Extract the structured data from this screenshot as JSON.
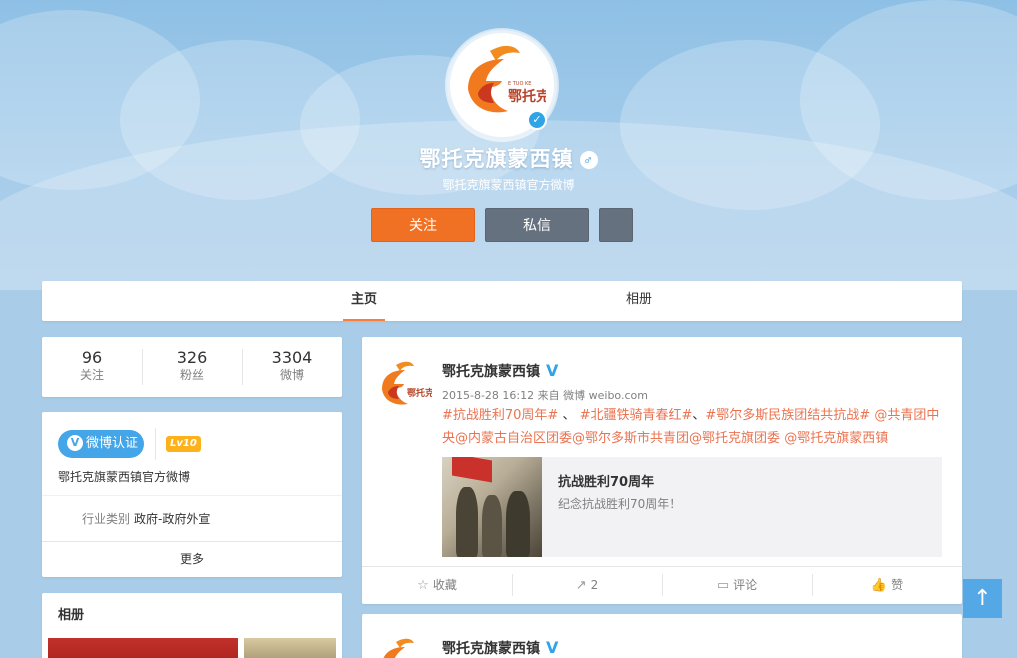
{
  "profile": {
    "name": "鄂托克旗蒙西镇",
    "description": "鄂托克旗蒙西镇官方微博",
    "gender_icon": "♂",
    "avatar_logo_text": "鄂托克",
    "avatar_logo_small": "E TUO KE"
  },
  "buttons": {
    "follow": "关注",
    "message": "私信",
    "more": ""
  },
  "tabs": [
    {
      "label": "主页",
      "active": true
    },
    {
      "label": "相册",
      "active": false
    }
  ],
  "stats": [
    {
      "value": "96",
      "label": "关注"
    },
    {
      "value": "326",
      "label": "粉丝"
    },
    {
      "value": "3304",
      "label": "微博"
    }
  ],
  "info": {
    "cert_label": "微博认证",
    "level": "Lv10",
    "desc": "鄂托克旗蒙西镇官方微博",
    "industry_key": "行业类别",
    "industry_value": "政府-政府外宣",
    "more": "更多"
  },
  "album": {
    "title": "相册"
  },
  "feed": {
    "user": "鄂托克旗蒙西镇",
    "time": "2015-8-28 16:12",
    "source_prefix": "来自",
    "source": "微博 weibo.com",
    "text_parts": [
      "#抗战胜利70周年#",
      " 、 ",
      "#北疆铁骑青春红#",
      "、",
      "#鄂尔多斯民族团结共抗战#",
      " ",
      "@共青团中央",
      "@内蒙古自治区团委",
      "@鄂尔多斯市共青团",
      "@鄂托克旗团委",
      " ",
      "@鄂托克旗蒙西镇"
    ],
    "card_title": "抗战胜利70周年",
    "card_sub": "纪念抗战胜利70周年！",
    "actions": [
      {
        "icon": "☆",
        "label": "收藏"
      },
      {
        "icon": "↗",
        "label": "2"
      },
      {
        "icon": "▭",
        "label": "评论"
      },
      {
        "icon": "👍",
        "label": "赞"
      }
    ]
  },
  "feed2": {
    "user": "鄂托克旗蒙西镇"
  },
  "colors": {
    "accent_orange": "#f17124",
    "link": "#eb7350",
    "verified_blue": "#2fa4e7",
    "sky": "#a9cde9"
  },
  "back_to_top_icon": "↑"
}
